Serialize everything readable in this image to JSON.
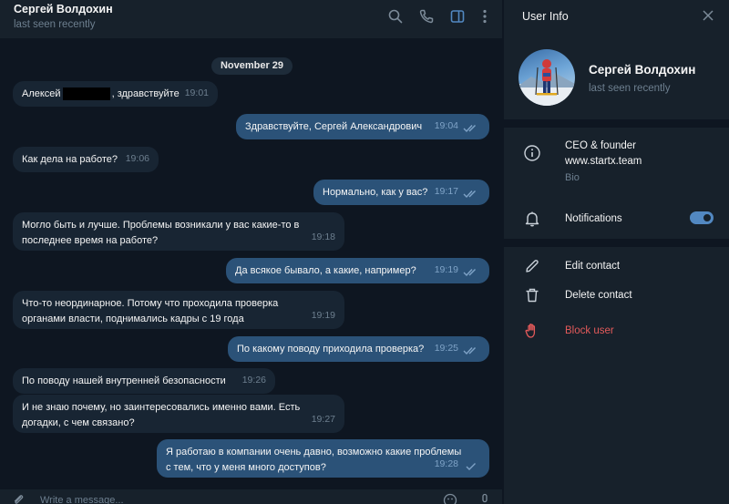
{
  "chat": {
    "title": "Сергей Волдохин",
    "status": "last seen recently",
    "date": "November 29",
    "composer_placeholder": "Write a message...",
    "messages": [
      {
        "dir": "in",
        "parts": [
          "Алексей",
          ", здравствуйте"
        ],
        "time": "19:01"
      },
      {
        "dir": "out",
        "text": "Здравствуйте, Сергей Александрович",
        "time": "19:04"
      },
      {
        "dir": "in",
        "text": "Как дела на работе?",
        "time": "19:06"
      },
      {
        "dir": "out",
        "text": "Нормально, как у вас?",
        "time": "19:17"
      },
      {
        "dir": "in",
        "text": "Могло быть и лучше. Проблемы возникали у вас какие-то в",
        "text2": "последнее время на работе?",
        "time": "19:18"
      },
      {
        "dir": "out",
        "text": "Да всякое бывало, а какие, например?",
        "time": "19:19"
      },
      {
        "dir": "in",
        "text": "Что-то неординарное. Потому что проходила проверка",
        "text2": "органами власти, поднимались кадры с 19 года",
        "time": "19:19"
      },
      {
        "dir": "out",
        "text": "По какому поводу приходила проверка?",
        "time": "19:25"
      },
      {
        "dir": "in",
        "text": "По поводу нашей внутренней безопасности",
        "time": "19:26"
      },
      {
        "dir": "in",
        "text": "И не знаю почему, но заинтересовались именно вами. Есть",
        "text2": "догадки, с чем связано?",
        "time": "19:27"
      },
      {
        "dir": "out",
        "text": "Я работаю в компании очень давно, возможно какие проблемы",
        "text2": "с тем, что у меня много доступов?",
        "time": "19:28"
      }
    ]
  },
  "info": {
    "title": "User Info",
    "name": "Сергей Волдохин",
    "status": "last seen recently",
    "bio_line1": "CEO & founder",
    "bio_line2": "www.startx.team",
    "bio_label": "Bio",
    "notifications": "Notifications",
    "notifications_on": true,
    "edit_contact": "Edit contact",
    "delete_contact": "Delete contact",
    "block_user": "Block user"
  },
  "colors": {
    "accent": "#5288c1",
    "outgoing_bubble": "#2b5278",
    "incoming_bubble": "#182533",
    "danger": "#e35a5a"
  },
  "icons": [
    "search-icon",
    "phone-icon",
    "sidebar-icon",
    "more-icon",
    "close-icon",
    "info-icon",
    "bell-icon",
    "pencil-icon",
    "trash-icon",
    "hand-icon",
    "attach-icon",
    "emoji-icon",
    "mic-icon",
    "double-check-icon",
    "check-icon"
  ]
}
